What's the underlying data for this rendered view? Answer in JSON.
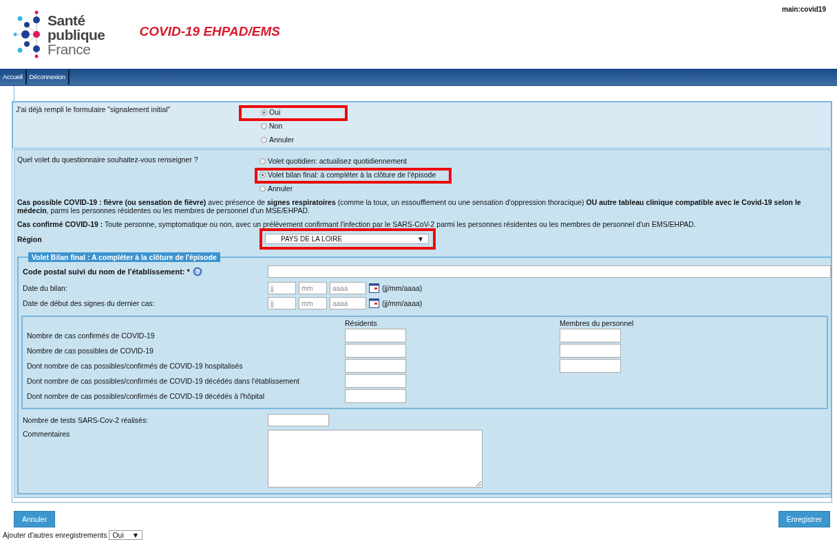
{
  "header": {
    "logo_lines": [
      "Santé",
      "publique",
      "France"
    ],
    "app_title": "COVID-19 EHPAD/EMS",
    "user": "main:covid19"
  },
  "nav": [
    {
      "label": "Accueil"
    },
    {
      "label": "Déconnexion"
    }
  ],
  "question_initial": {
    "label": "J'ai déjà rempli le formulaire \"signalement initial\"",
    "options": [
      {
        "label": "Oui",
        "selected": true,
        "highlighted": true
      },
      {
        "label": "Non",
        "selected": false,
        "highlighted": false
      },
      {
        "label": "Annuler",
        "selected": false,
        "highlighted": false
      }
    ]
  },
  "question_part": {
    "label": "Quel volet du questionnaire souhaitez-vous renseigner ?",
    "options": [
      {
        "label": "Volet quotidien: actualisez quotidiennement",
        "selected": false,
        "highlighted": false
      },
      {
        "label": "Volet bilan final: à compléter à la clôture de l'épisode",
        "selected": true,
        "highlighted": true
      },
      {
        "label": "Annuler",
        "selected": false,
        "highlighted": false
      }
    ]
  },
  "definitions": [
    "**Cas possible COVID-19 : fièvre (ou sensation de fièvre)** avec présence de **signes respiratoires** (comme la toux, un essoufflement ou une sensation d'oppression thoracique) **OU autre tableau clinique compatible avec le Covid-19 selon le médecin**, parmi les personnes résidentes ou les membres de personnel d'un MSE/EHPAD.",
    "**Cas confirmé COVID-19 :** Toute personne, symptomatique ou non, avec un prélèvement confirmant l'infection par le SARS-CoV-2 parmi les personnes résidentes ou les membres de personnel d'un EMS/EHPAD."
  ],
  "region": {
    "label": "Région",
    "value": "PAYS DE LA LOIRE",
    "arrow": "▼",
    "highlighted": true
  },
  "final_section": {
    "legend": "Volet Bilan final : A compléter à la clôture de l'épisode",
    "postal_label": "Code postal suivi du nom de l'établissement: *",
    "dates": [
      {
        "label": "Date du bilan:",
        "placeholders": [
          "jj",
          "mm",
          "aaaa"
        ],
        "format": "(jj/mm/aaaa)"
      },
      {
        "label": "Date de début des signes du dernier cas:",
        "placeholders": [
          "jj",
          "mm",
          "aaaa"
        ],
        "format": "(jj/mm/aaaa)"
      }
    ],
    "counts": {
      "columns": [
        "Résidents",
        "Membres du personnel"
      ],
      "rows": [
        {
          "label": "Nombre de cas confirmés de COVID-19",
          "staff_field": true
        },
        {
          "label": "Nombre de cas possibles de COVID-19",
          "staff_field": true
        },
        {
          "label": "Dont nombre de cas possibles/confirmés de COVID-19 hospitalisés",
          "staff_field": true
        },
        {
          "label": "Dont nombre de cas possibles/confirmés de COVID-19 décédés dans l'établissement",
          "staff_field": false
        },
        {
          "label": "Dont nombre de cas possibles/confirmés de COVID-19 décédés à l'hôpital",
          "staff_field": false
        }
      ]
    },
    "tests_label": "Nombre de tests SARS-Cov-2 réalisés:",
    "comments_label": "Commentaires"
  },
  "buttons": {
    "cancel": "Annuler",
    "save": "Enregistrer"
  },
  "add_more": {
    "label": "Ajouter d'autres enregistrements",
    "value": "Oui",
    "arrow": "▼"
  }
}
